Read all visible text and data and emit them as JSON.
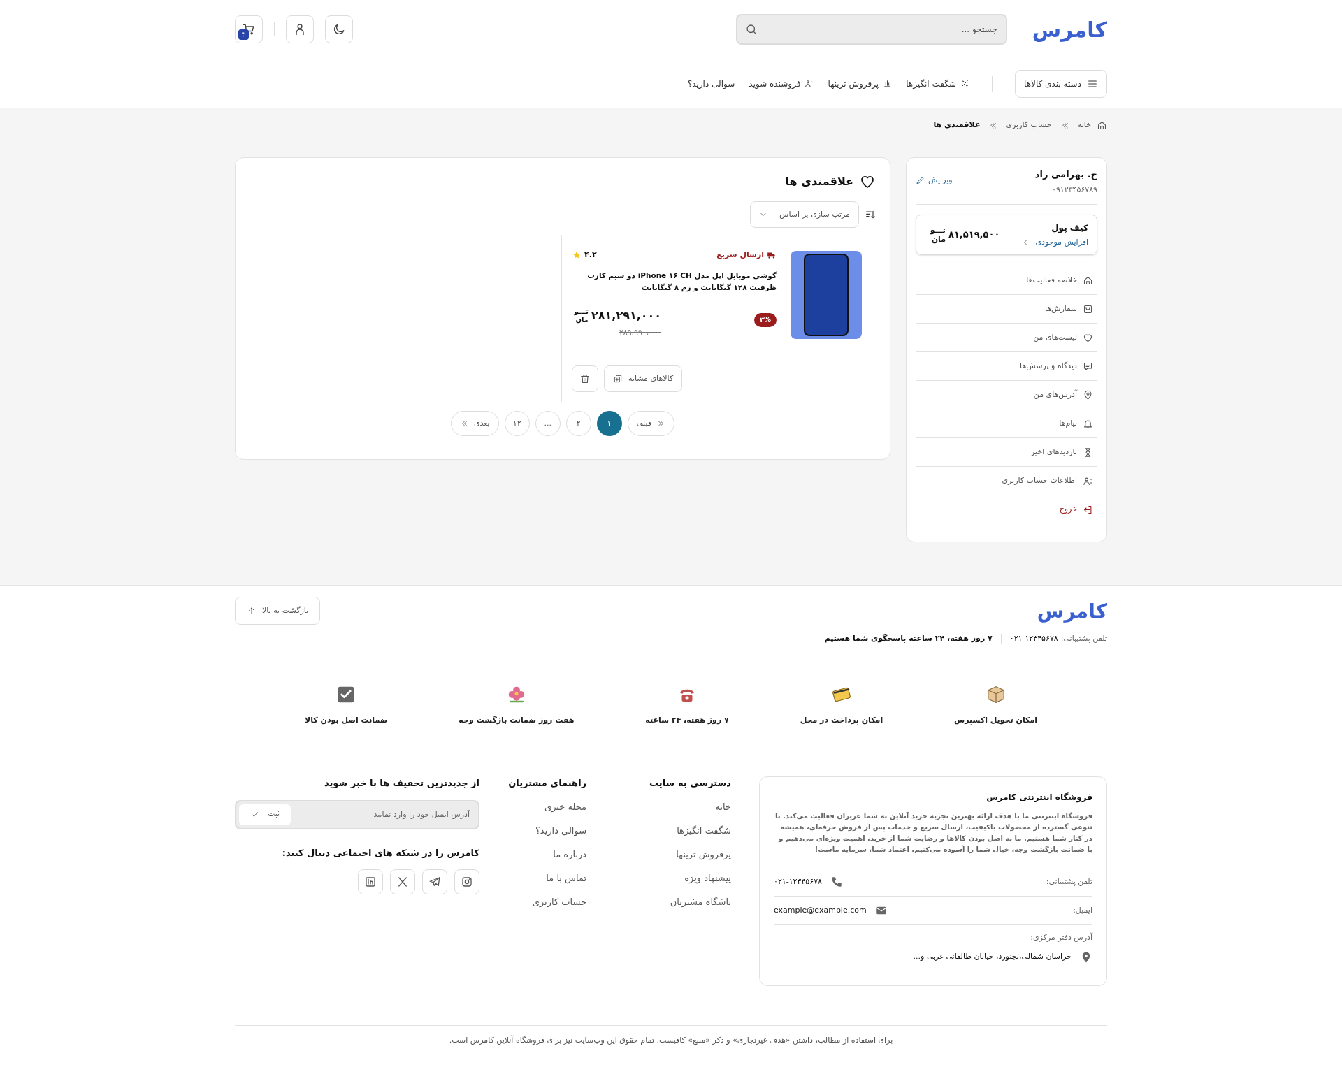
{
  "header": {
    "logo": "کامرس",
    "search": {
      "placeholder": "جستجو ..."
    },
    "cart_count": "۳"
  },
  "nav": {
    "categories_button": "دسته بندی کالاها",
    "links": [
      "شگفت انگیزها",
      "پرفروش ترینها",
      "فروشنده شوید",
      "سوالی دارید؟"
    ]
  },
  "breadcrumb": [
    {
      "label": "خانه",
      "current": false
    },
    {
      "label": "حساب کاربری",
      "current": false
    },
    {
      "label": "علاقمندی ها",
      "current": true
    }
  ],
  "account": {
    "name": "ج. بهرامی راد",
    "phone": "۰۹۱۲۳۴۵۶۷۸۹",
    "edit": "ویرایش",
    "wallet": {
      "title": "کیف پول",
      "action": "افزایش موجودی",
      "amount": "۸۱,۵۱۹,۵۰۰",
      "currency": "تـــو مان"
    },
    "menu": [
      {
        "label": "خلاصه فعالیت‌ها",
        "kind": "normal"
      },
      {
        "label": "سفارش‌ها",
        "kind": "normal"
      },
      {
        "label": "لیست‌های من",
        "kind": "normal"
      },
      {
        "label": "دیدگاه و پرسش‌ها",
        "kind": "normal"
      },
      {
        "label": "آدرس‌های من",
        "kind": "normal"
      },
      {
        "label": "پیام‌ها",
        "kind": "normal"
      },
      {
        "label": "بازدیدهای اخیر",
        "kind": "normal"
      },
      {
        "label": "اطلاعات حساب کاربری",
        "kind": "normal"
      },
      {
        "label": "خروج",
        "kind": "danger"
      }
    ]
  },
  "wishlist": {
    "title": "علاقمندی ها",
    "sort_label": "مرتب سازی بر اساس",
    "products": [
      {
        "badge": "ارسال سریع",
        "rating": "۴.۲",
        "title": "گوشی موبایل اپل مدل iPhone ۱۶ CH دو سیم کارت ظرفیت ۱۲۸ گیگابایت و رم ۸ گیگابایت",
        "discount": "۳%",
        "price": "۲۸۱,۲۹۱,۰۰۰",
        "currency": "تـــو مان",
        "old_price": "۲۸۹,۹۹۰,۰۰۰",
        "similar_button": "کالاهای مشابه"
      }
    ],
    "pagination": {
      "prev": "قبلی",
      "next": "بعدی",
      "pages": [
        {
          "label": "۱",
          "selected": true
        },
        {
          "label": "۲",
          "selected": false
        },
        {
          "label": "...",
          "selected": false
        },
        {
          "label": "۱۲",
          "selected": false
        }
      ]
    }
  },
  "footer": {
    "logo": "کامرس",
    "back_to_top": "بازگشت به بالا",
    "support_label": "تلفن پشتیبانی:",
    "support_phone": "۰۲۱-۱۲۳۴۵۶۷۸",
    "hours": "۷ روز هفته، ۲۴ ساعته پاسخگوی شما هستیم",
    "features": [
      "امکان تحویل اکسپرس",
      "امکان پرداخت در محل",
      "۷ روز هفته، ۲۴ ساعته",
      "هفت روز ضمانت بازگشت وجه",
      "ضمانت اصل بودن کالا"
    ],
    "about": {
      "title": "فروشگاه اینترنتی کامرس",
      "text": "فروشگاه اینترنتی ما با هدف ارائه بهترین تجربه خرید آنلاین به شما عزیزان فعالیت می‌کند. با تنوعی گسترده از محصولات باکیفیت، ارسال سریع و خدمات پس از فروش حرفه‌ای، همیشه در کنار شما هستیم. ما به اصل بودن کالاها و رضایت شما از خرید، اهمیت ویژه‌ای می‌دهیم و با ضمانت بازگشت وجه، خیال شما را آسوده می‌کنیم. اعتماد شما، سرمایه ماست!",
      "rows": [
        {
          "kind": "phone",
          "label": "تلفن پشتیبانی:",
          "value": "۰۲۱-۱۲۳۴۵۶۷۸"
        },
        {
          "kind": "email",
          "label": "ایمیل:",
          "value": "example@example.com"
        },
        {
          "kind": "address",
          "label": "آدرس دفتر مرکزی:",
          "value": "خراسان شمالی،بجنورد، خیابان طالقانی غربی و..."
        }
      ]
    },
    "columns": [
      {
        "title": "دسترسی به سایت",
        "links": [
          "خانه",
          "شگفت انگیزها",
          "پرفروش ترینها",
          "پیشنهاد ویژه",
          "باشگاه مشتریان"
        ]
      },
      {
        "title": "راهنمای مشتریان",
        "links": [
          "مجله خبری",
          "سوالی دارید؟",
          "درباره ما",
          "تماس با ما",
          "حساب کاربری"
        ]
      }
    ],
    "newsletter": {
      "title": "از جدیدترین تخفیف ها با خبر شوید",
      "placeholder": "آدرس ایمیل خود را وارد نمایید",
      "submit": "ثبت"
    },
    "social_title": "کامرس را در شبکه های اجتماعی دنبال کنید:"
  },
  "copyright": "برای استفاده از مطالب، داشتن «هدف غیرتجاری» و ذکر «منبع» کافیست. تمام حقوق این وب‌سایت نیز برای فروشگاه آنلاین کامرس است."
}
